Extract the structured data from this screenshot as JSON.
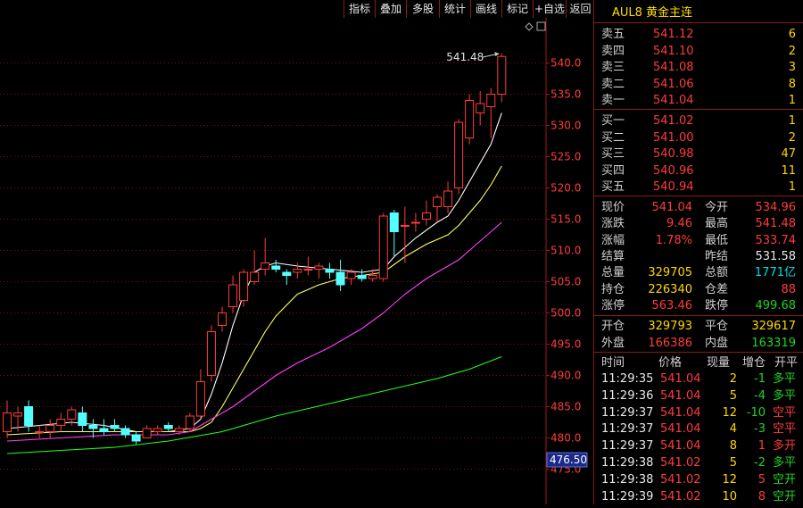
{
  "toolbar": {
    "buttons": [
      "指标",
      "叠加",
      "多股",
      "统计",
      "画线",
      "标记",
      "+自选",
      "返回"
    ]
  },
  "chart": {
    "high_label": "541.48",
    "price_tag": "476.50",
    "y_ticks": [
      "540.0",
      "535.0",
      "530.0",
      "525.0",
      "520.0",
      "515.0",
      "510.0",
      "505.0",
      "500.0",
      "495.0",
      "490.0",
      "485.0",
      "480.0",
      "475.0"
    ],
    "colors": {
      "up": "#ff3b3b",
      "down": "#54ffff",
      "ma1": "#ffffff",
      "ma2": "#ffff60",
      "ma3": "#ff40ff",
      "ma4": "#20ff20",
      "grid": "#7a1010"
    }
  },
  "chart_data": {
    "type": "candlestick",
    "y_range": [
      473.5,
      543.5
    ],
    "candles": [
      {
        "o": 481,
        "h": 486,
        "l": 480,
        "c": 484
      },
      {
        "o": 483.5,
        "h": 485,
        "l": 481,
        "c": 484
      },
      {
        "o": 485,
        "h": 486,
        "l": 481,
        "c": 482
      },
      {
        "o": 481,
        "h": 482,
        "l": 480,
        "c": 481
      },
      {
        "o": 481,
        "h": 483,
        "l": 480,
        "c": 482
      },
      {
        "o": 482,
        "h": 484,
        "l": 481,
        "c": 483
      },
      {
        "o": 483,
        "h": 485,
        "l": 482,
        "c": 484.5
      },
      {
        "o": 484,
        "h": 485,
        "l": 481,
        "c": 482
      },
      {
        "o": 482,
        "h": 483,
        "l": 480,
        "c": 481.5
      },
      {
        "o": 481.5,
        "h": 483,
        "l": 480.5,
        "c": 481
      },
      {
        "o": 482,
        "h": 483,
        "l": 481,
        "c": 481.5
      },
      {
        "o": 481.5,
        "h": 482,
        "l": 480,
        "c": 480.5
      },
      {
        "o": 480.5,
        "h": 481,
        "l": 479,
        "c": 479.5
      },
      {
        "o": 480,
        "h": 482,
        "l": 480,
        "c": 481.5
      },
      {
        "o": 481,
        "h": 482,
        "l": 480.5,
        "c": 481.5
      },
      {
        "o": 482,
        "h": 482.5,
        "l": 481,
        "c": 481.5
      },
      {
        "o": 481,
        "h": 482,
        "l": 480.5,
        "c": 481.5
      },
      {
        "o": 481.5,
        "h": 484,
        "l": 481,
        "c": 483.5
      },
      {
        "o": 483.5,
        "h": 491,
        "l": 483,
        "c": 489
      },
      {
        "o": 490,
        "h": 498,
        "l": 489,
        "c": 497
      },
      {
        "o": 498,
        "h": 501,
        "l": 497,
        "c": 500
      },
      {
        "o": 501,
        "h": 506,
        "l": 500,
        "c": 504.5
      },
      {
        "o": 502,
        "h": 507,
        "l": 501,
        "c": 506.5
      },
      {
        "o": 505,
        "h": 510,
        "l": 504.5,
        "c": 506.5
      },
      {
        "o": 507,
        "h": 512,
        "l": 506,
        "c": 508
      },
      {
        "o": 507.5,
        "h": 508.5,
        "l": 506.5,
        "c": 507
      },
      {
        "o": 506.5,
        "h": 507,
        "l": 504.5,
        "c": 506
      },
      {
        "o": 506.5,
        "h": 508,
        "l": 505.5,
        "c": 507
      },
      {
        "o": 507,
        "h": 509,
        "l": 506,
        "c": 507
      },
      {
        "o": 507,
        "h": 508,
        "l": 505.5,
        "c": 507.5
      },
      {
        "o": 507,
        "h": 508,
        "l": 505.5,
        "c": 506.5
      },
      {
        "o": 506.5,
        "h": 508.5,
        "l": 503.5,
        "c": 504.5
      },
      {
        "o": 505.5,
        "h": 507,
        "l": 504.5,
        "c": 506.5
      },
      {
        "o": 506,
        "h": 507,
        "l": 505,
        "c": 505.5
      },
      {
        "o": 505.5,
        "h": 507,
        "l": 505,
        "c": 506
      },
      {
        "o": 505.5,
        "h": 516,
        "l": 505,
        "c": 515.5
      },
      {
        "o": 516,
        "h": 516.5,
        "l": 509,
        "c": 513
      },
      {
        "o": 514,
        "h": 517,
        "l": 508,
        "c": 514
      },
      {
        "o": 514.5,
        "h": 516,
        "l": 513,
        "c": 514.5
      },
      {
        "o": 515,
        "h": 518,
        "l": 514,
        "c": 516
      },
      {
        "o": 517,
        "h": 519,
        "l": 514.5,
        "c": 518.5
      },
      {
        "o": 517,
        "h": 521,
        "l": 516,
        "c": 519.5
      },
      {
        "o": 520,
        "h": 531,
        "l": 519,
        "c": 530.5
      },
      {
        "o": 528,
        "h": 535,
        "l": 527,
        "c": 534
      },
      {
        "o": 532,
        "h": 535.5,
        "l": 530,
        "c": 533.5
      },
      {
        "o": 533,
        "h": 536,
        "l": 528,
        "c": 535
      },
      {
        "o": 535,
        "h": 541.48,
        "l": 533.74,
        "c": 541.04
      }
    ],
    "ma": [
      {
        "name": "ma1",
        "x": [
          0,
          3,
          6,
          9,
          12,
          15,
          17,
          18,
          19,
          20,
          21,
          22,
          23,
          24,
          25,
          27,
          30,
          33,
          35,
          36,
          38,
          40,
          41,
          42,
          43,
          44,
          45,
          46
        ],
        "y": [
          481.5,
          482,
          482.5,
          482,
          481,
          481,
          481.5,
          483,
          487,
          492,
          498,
          503,
          506.5,
          507.5,
          508,
          507.5,
          507,
          506.5,
          507,
          509,
          512,
          514.5,
          515.5,
          518,
          521,
          524,
          527,
          532
        ]
      },
      {
        "name": "ma2",
        "x": [
          0,
          5,
          10,
          15,
          17,
          18,
          19,
          20,
          21,
          22,
          23,
          24,
          25,
          27,
          29,
          31,
          33,
          35,
          37,
          39,
          41,
          42,
          43,
          44,
          45,
          46
        ],
        "y": [
          480.5,
          481,
          481,
          481,
          481,
          481.5,
          482.5,
          485,
          488,
          491,
          494,
          497,
          499.5,
          503,
          504.5,
          505.5,
          506,
          506.5,
          509,
          511,
          512.5,
          514,
          516,
          518,
          520.5,
          523.5
        ]
      },
      {
        "name": "ma3",
        "x": [
          0,
          5,
          10,
          15,
          17,
          19,
          21,
          23,
          25,
          27,
          30,
          33,
          35,
          37,
          39,
          41,
          42,
          43,
          44,
          45,
          46
        ],
        "y": [
          479.5,
          480,
          480.5,
          480.5,
          481,
          483,
          485,
          487.5,
          490,
          492,
          494.5,
          497.5,
          500,
          503,
          505.5,
          507.5,
          508.5,
          510,
          511.5,
          513,
          514.5
        ]
      },
      {
        "name": "ma4",
        "x": [
          0,
          5,
          10,
          15,
          20,
          25,
          30,
          35,
          40,
          43,
          46
        ],
        "y": [
          477.5,
          478,
          478.5,
          479.5,
          481,
          483.5,
          485.5,
          487.5,
          489.5,
          491,
          493
        ]
      }
    ]
  },
  "panel": {
    "title": "AUL8  黄金主连",
    "asks": [
      {
        "label": "卖五",
        "price": "541.12",
        "vol": "6"
      },
      {
        "label": "卖四",
        "price": "541.10",
        "vol": "2"
      },
      {
        "label": "卖三",
        "price": "541.08",
        "vol": "3"
      },
      {
        "label": "卖二",
        "price": "541.06",
        "vol": "8"
      },
      {
        "label": "卖一",
        "price": "541.04",
        "vol": "1"
      }
    ],
    "bids": [
      {
        "label": "买一",
        "price": "541.02",
        "vol": "1"
      },
      {
        "label": "买二",
        "price": "541.00",
        "vol": "2"
      },
      {
        "label": "买三",
        "price": "540.98",
        "vol": "47"
      },
      {
        "label": "买四",
        "price": "540.96",
        "vol": "11"
      },
      {
        "label": "买五",
        "price": "540.94",
        "vol": "1"
      }
    ],
    "stats": [
      {
        "l1": "现价",
        "v1": "541.04",
        "c1": "red",
        "l2": "今开",
        "v2": "534.96",
        "c2": "red"
      },
      {
        "l1": "涨跌",
        "v1": "9.46",
        "c1": "red",
        "l2": "最高",
        "v2": "541.48",
        "c2": "red"
      },
      {
        "l1": "涨幅",
        "v1": "1.78%",
        "c1": "red",
        "l2": "最低",
        "v2": "533.74",
        "c2": "red"
      },
      {
        "l1": "结算",
        "v1": "",
        "c1": "white",
        "l2": "昨结",
        "v2": "531.58",
        "c2": "white"
      },
      {
        "l1": "总量",
        "v1": "329705",
        "c1": "yellow",
        "l2": "总额",
        "v2": "1771亿",
        "c2": "cyan"
      },
      {
        "l1": "持仓",
        "v1": "226340",
        "c1": "yellow",
        "l2": "仓差",
        "v2": "88",
        "c2": "red"
      },
      {
        "l1": "涨停",
        "v1": "563.46",
        "c1": "red",
        "l2": "跌停",
        "v2": "499.68",
        "c2": "green"
      }
    ],
    "oc": [
      {
        "l1": "开仓",
        "v1": "329793",
        "c1": "yellow",
        "l2": "平仓",
        "v2": "329617",
        "c2": "yellow"
      },
      {
        "l1": "外盘",
        "v1": "166386",
        "c1": "red",
        "l2": "内盘",
        "v2": "163319",
        "c2": "green"
      }
    ],
    "ticks_header": [
      "时间",
      "价格",
      "现量",
      "增仓",
      "开平"
    ],
    "ticks": [
      {
        "time": "11:29:35",
        "price": "541.04",
        "vol": "2",
        "inc": "-1",
        "type": "多平",
        "tc": "green"
      },
      {
        "time": "11:29:36",
        "price": "541.04",
        "vol": "5",
        "inc": "-4",
        "type": "多平",
        "tc": "green"
      },
      {
        "time": "11:29:37",
        "price": "541.04",
        "vol": "12",
        "inc": "-10",
        "type": "空平",
        "tc": "red"
      },
      {
        "time": "11:29:37",
        "price": "541.04",
        "vol": "4",
        "inc": "-3",
        "type": "空平",
        "tc": "red"
      },
      {
        "time": "11:29:37",
        "price": "541.04",
        "vol": "8",
        "inc": "1",
        "type": "多开",
        "tc": "red"
      },
      {
        "time": "11:29:38",
        "price": "541.02",
        "vol": "5",
        "inc": "-2",
        "type": "多平",
        "tc": "green"
      },
      {
        "time": "11:29:38",
        "price": "541.02",
        "vol": "12",
        "inc": "5",
        "type": "空开",
        "tc": "green"
      },
      {
        "time": "11:29:39",
        "price": "541.02",
        "vol": "10",
        "inc": "8",
        "type": "空开",
        "tc": "green"
      }
    ]
  }
}
